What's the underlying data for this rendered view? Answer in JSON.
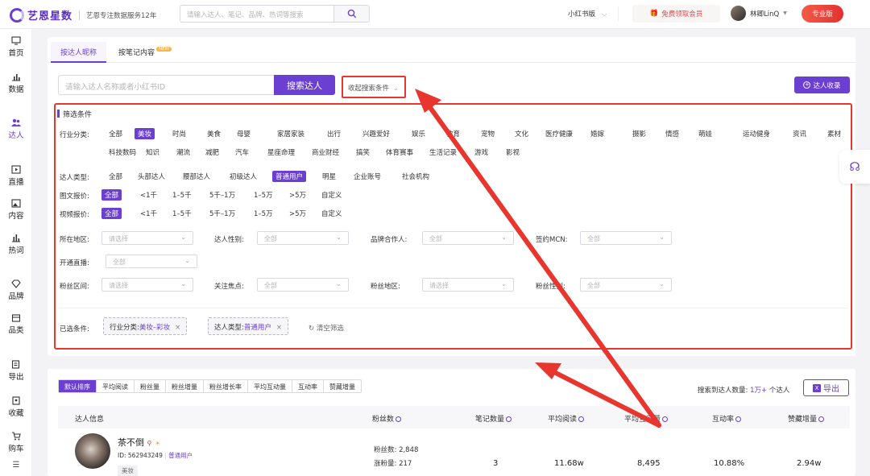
{
  "brand": {
    "name": "艺恩星数",
    "tagline": "艺恩专注数据服务12年",
    "accent": "#6b3fd1",
    "highlight": "#e8352e"
  },
  "topbar": {
    "search_placeholder": "请输入达人、笔记、品牌、热词等搜索",
    "platform": "小红书版",
    "vip_label": "免费领取会员",
    "user_name": "林卿LinQ",
    "pro_label": "专业版"
  },
  "sidebar": [
    {
      "label": "首页",
      "icon": "monitor-icon"
    },
    {
      "label": "数据",
      "icon": "bar-chart-icon"
    },
    {
      "label": "达人",
      "icon": "people-icon",
      "active": true
    },
    {
      "label": "直播",
      "icon": "play-icon"
    },
    {
      "label": "内容",
      "icon": "image-icon"
    },
    {
      "label": "热词",
      "icon": "chart-icon"
    },
    {
      "label": "品牌",
      "icon": "diamond-icon"
    },
    {
      "label": "品类",
      "icon": "box-icon"
    },
    {
      "label": "导出",
      "icon": "export-icon"
    },
    {
      "label": "收藏",
      "icon": "bookmark-icon"
    },
    {
      "label": "购车",
      "icon": "cart-icon"
    }
  ],
  "tabs": [
    {
      "label": "按达人昵称",
      "active": true
    },
    {
      "label": "按笔记内容",
      "tag": "NEW"
    }
  ],
  "search": {
    "placeholder": "请输入达人名称或者小红书ID",
    "button": "搜索达人",
    "collapse": "收起搜索条件",
    "collect": "达人收录"
  },
  "filters": {
    "title": "筛选条件",
    "industry_label": "行业分类:",
    "industry_row1": [
      "全部",
      "美妆",
      "时尚",
      "美食",
      "母婴",
      "家居家装",
      "出行",
      "兴趣爱好",
      "娱乐",
      "教育",
      "宠物",
      "文化",
      "医疗健康",
      "婚嫁",
      "摄影",
      "情感",
      "萌娃",
      "运动健身",
      "资讯",
      "素材"
    ],
    "industry_row2": [
      "科技数码",
      "知识",
      "潮流",
      "减肥",
      "汽车",
      "星座命理",
      "商业财经",
      "搞笑",
      "体育赛事",
      "生活记录",
      "游戏",
      "影视"
    ],
    "industry_selected": "美妆",
    "type_label": "达人类型:",
    "types": [
      "全部",
      "头部达人",
      "腰部达人",
      "初级达人",
      "普通用户",
      "明星",
      "企业账号",
      "社会机构"
    ],
    "type_selected": "普通用户",
    "image_price_label": "图文报价:",
    "video_price_label": "视频报价:",
    "prices": [
      "全部",
      "<1千",
      "1–5千",
      "5千–1万",
      "1–5万",
      ">5万",
      "自定义"
    ],
    "price_selected": "全部",
    "region_label": "所在地区:",
    "region_placeholder": "请选择",
    "gender_label": "达人性别:",
    "gender_placeholder": "全部",
    "brand_coop_label": "品牌合作人:",
    "brand_coop_placeholder": "全部",
    "mcn_label": "签约MCN:",
    "mcn_placeholder": "全部",
    "live_label": "开通直播:",
    "live_placeholder": "全部",
    "fans_range_label": "粉丝区间:",
    "fans_range_placeholder": "请选择",
    "focus_label": "关注焦点:",
    "focus_placeholder": "全部",
    "fans_region_label": "粉丝地区:",
    "fans_region_placeholder": "请选择",
    "fans_gender_label": "粉丝性别:",
    "fans_gender_placeholder": "全部",
    "selected_label": "已选条件:",
    "chips": [
      {
        "k": "行业分类:",
        "v": "美妆–彩妆"
      },
      {
        "k": "达人类型:",
        "v": "普通用户"
      }
    ],
    "clear": "清空筛选"
  },
  "results": {
    "sort_tabs": [
      "默认排序",
      "平均阅读",
      "粉丝量",
      "粉丝增量",
      "粉丝增长率",
      "平均互动量",
      "互动率",
      "赞藏增量"
    ],
    "sort_selected": "默认排序",
    "found_prefix": "搜索到达人数量:",
    "found_count": "1万+",
    "found_suffix": "个达人",
    "export": "导出",
    "columns": [
      "达人信息",
      "粉丝数",
      "笔记数量",
      "平均阅读",
      "平均互动量",
      "互动率",
      "赞藏增量"
    ],
    "row": {
      "name": "茶不倒",
      "id_text": "ID: 562943249",
      "type": "普通用户",
      "tag": "美妆",
      "fans_line": "粉丝数: 2,848",
      "growth_line": "涨粉量: 217",
      "notes": "3",
      "avg_read": "11.68w",
      "avg_interact": "8,495",
      "interact_rate": "10.88%",
      "like_collect": "2.94w"
    }
  }
}
